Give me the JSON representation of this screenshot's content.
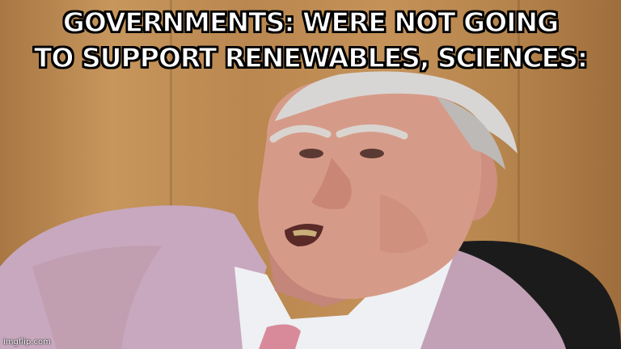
{
  "meme": {
    "caption_line_1": "GOVERNMENTS: WERE NOT GOING",
    "caption_line_2": "TO SUPPORT RENEWABLES, SCIENCES:",
    "watermark": "imgflip.com"
  },
  "colors": {
    "wall": "#b98a52",
    "jacket": "#c9a9c0",
    "shirt": "#eef0f4",
    "tie": "#d98a9a",
    "skin": "#d49a86",
    "hair": "#d8d6d4",
    "chair": "#1c1b1c"
  }
}
